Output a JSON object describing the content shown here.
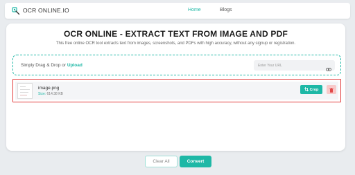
{
  "header": {
    "logo_text": "OCR ONLINE.IO",
    "nav": [
      {
        "label": "Home",
        "active": true
      },
      {
        "label": "Blogs",
        "active": false
      }
    ]
  },
  "main": {
    "title": "OCR ONLINE - EXTRACT TEXT FROM IMAGE AND PDF",
    "subtitle": "This free online OCR tool extracts text from images, screenshots, and PDFs with high accuracy, without any signup or registration.",
    "dropzone": {
      "prefix": "Simply Drag & Drop or ",
      "upload_link": "Upload",
      "url_placeholder": "Enter Your URL"
    },
    "file": {
      "name": "image.png",
      "size_label": "Size:",
      "size_value": "614.38 KB",
      "crop_label": "Crop"
    }
  },
  "actions": {
    "clear_label": "Clear All",
    "convert_label": "Convert"
  },
  "colors": {
    "accent": "#1eb8a6",
    "danger_border": "#e23b3b",
    "delete_bg": "#f8c9c9",
    "page_bg": "#e9ecef"
  },
  "icons": [
    "ocr-logo-icon",
    "link-icon",
    "crop-icon",
    "trash-icon"
  ]
}
